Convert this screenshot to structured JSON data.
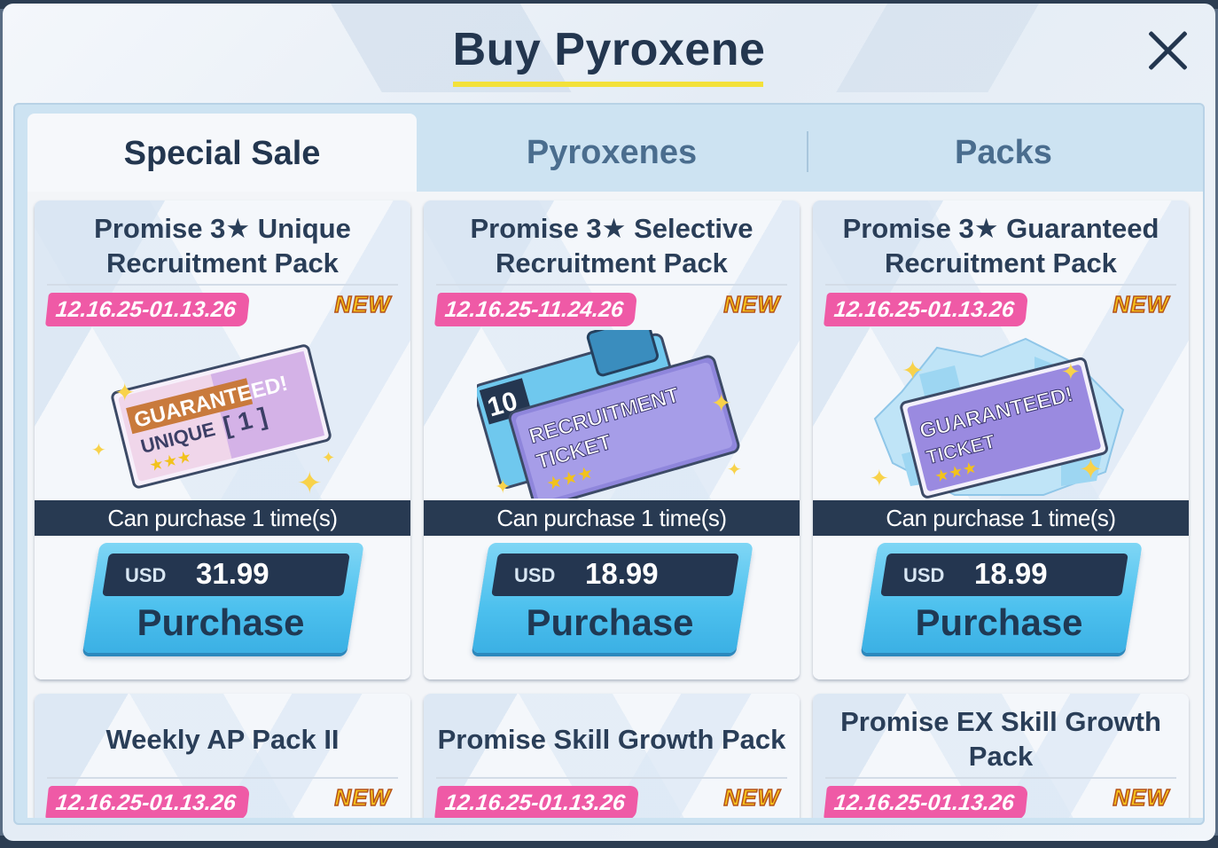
{
  "header": {
    "title": "Buy Pyroxene"
  },
  "tabs": [
    {
      "label": "Special Sale"
    },
    {
      "label": "Pyroxenes"
    },
    {
      "label": "Packs"
    }
  ],
  "cards": [
    {
      "title": "Promise 3★ Unique Recruitment Pack",
      "date": "12.16.25-01.13.26",
      "new": "NEW",
      "art_text_1": "GUARANTEED!",
      "art_text_2": "UNIQUE",
      "art_text_3": "[ 1 ]",
      "stars": "★★★",
      "limit": "Can purchase 1 time(s)",
      "currency": "USD",
      "price": "31.99",
      "button": "Purchase"
    },
    {
      "title": "Promise 3★ Selective Recruitment Pack",
      "date": "12.16.25-11.24.26",
      "new": "NEW",
      "art_text_1": "RECRUITMENT",
      "art_text_2": "TICKET",
      "art_text_3": "10",
      "stars": "★★★",
      "limit": "Can purchase 1 time(s)",
      "currency": "USD",
      "price": "18.99",
      "button": "Purchase"
    },
    {
      "title": "Promise 3★ Guaranteed Recruitment Pack",
      "date": "12.16.25-01.13.26",
      "new": "NEW",
      "art_text_1": "GUARANTEED!",
      "art_text_2": "TICKET",
      "stars": "★★★",
      "limit": "Can purchase 1 time(s)",
      "currency": "USD",
      "price": "18.99",
      "button": "Purchase"
    },
    {
      "title": "Weekly AP Pack II",
      "date": "12.16.25-01.13.26",
      "new": "NEW"
    },
    {
      "title": "Promise Skill Growth Pack",
      "date": "12.16.25-01.13.26",
      "new": "NEW"
    },
    {
      "title": "Promise EX Skill Growth Pack",
      "date": "12.16.25-01.13.26",
      "new": "NEW"
    }
  ],
  "colors": {
    "accent_yellow": "#f3e13a",
    "date_pink": "#ef5aa6",
    "button_blue": "#4cc0ee",
    "dark_navy": "#243650"
  },
  "icons": [
    "close-icon",
    "ticket-icon",
    "diamond-icon",
    "sparkle-icon"
  ]
}
